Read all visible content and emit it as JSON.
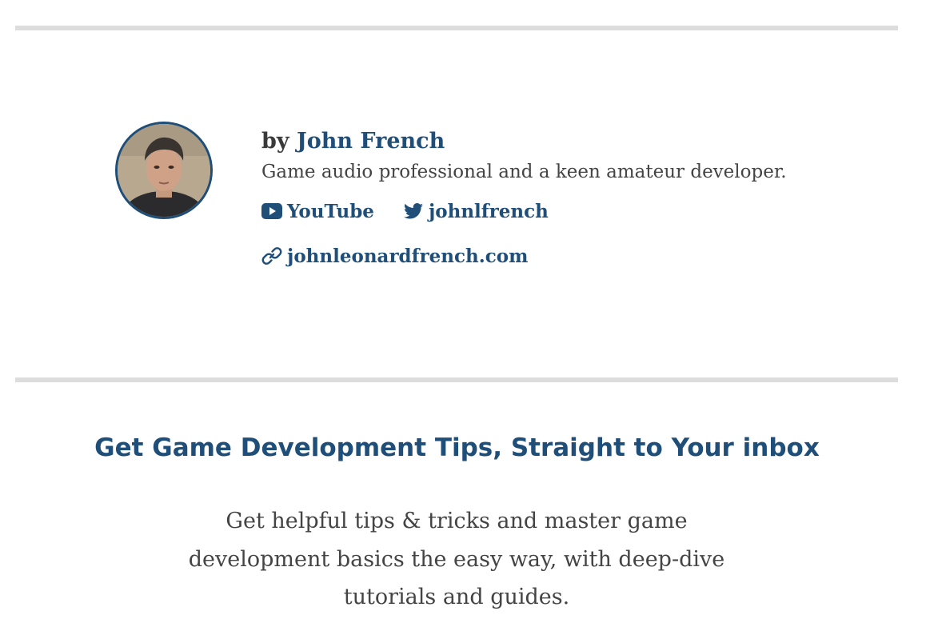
{
  "author": {
    "by_label": "by",
    "name": "John French",
    "bio": "Game audio professional and a keen amateur developer.",
    "avatar_icon": "author-photo",
    "social": [
      {
        "label": "YouTube",
        "icon": "youtube-icon"
      },
      {
        "label": "johnlfrench",
        "icon": "twitter-icon"
      }
    ],
    "website": {
      "label": "johnleonardfrench.com",
      "icon": "link-icon"
    }
  },
  "newsletter": {
    "title": "Get Game Development Tips, Straight to Your inbox",
    "description": "Get helpful tips & tricks and master game development basics the easy way, with deep-dive tutorials and guides."
  },
  "colors": {
    "accent": "#1f4e79",
    "text": "#444444",
    "divider": "#dddddd"
  }
}
